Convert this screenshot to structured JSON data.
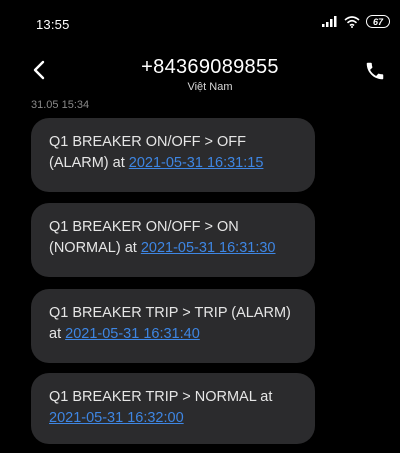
{
  "status_bar": {
    "time": "13:55",
    "battery": "67",
    "signal_icon": "signal-bars-icon",
    "wifi_icon": "wifi-icon"
  },
  "header": {
    "title": "+84369089855",
    "subtitle": "Việt Nam",
    "back_icon": "chevron-left-icon",
    "call_icon": "phone-icon"
  },
  "conversation": {
    "date_label": "31.05 15:34",
    "messages": [
      {
        "text": "Q1 BREAKER ON/OFF > OFF (ALARM) at ",
        "link": "2021-05-31 16:31:15"
      },
      {
        "text": "Q1 BREAKER ON/OFF > ON (NORMAL) at ",
        "link": "2021-05-31 16:31:30"
      },
      {
        "text": "Q1 BREAKER TRIP > TRIP (ALARM) at ",
        "link": "2021-05-31 16:31:40"
      },
      {
        "text": "Q1 BREAKER TRIP > NORMAL at ",
        "link": "2021-05-31 16:32:00"
      }
    ]
  },
  "colors": {
    "background": "#000000",
    "bubble": "#2b2b2d",
    "link": "#3e86e3",
    "text": "#e6e6e6"
  }
}
